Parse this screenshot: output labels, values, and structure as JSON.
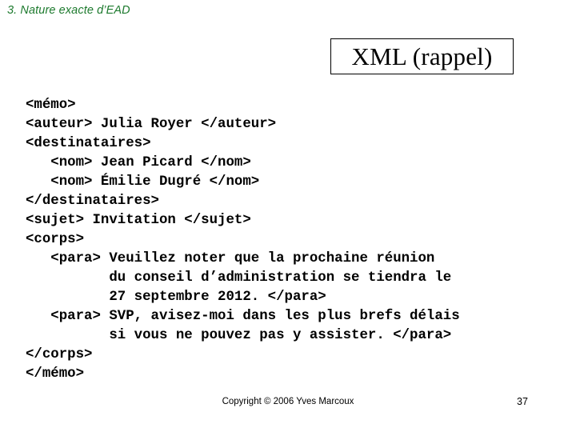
{
  "slide": {
    "section_header": "3. Nature exacte d’EAD",
    "header_color": "#1d7a2e",
    "background_color": "#ffffff",
    "title": "XML (rappel)"
  },
  "code": {
    "language": "xml",
    "lines": [
      "<mémo>",
      "<auteur> Julia Royer </auteur>",
      "<destinataires>",
      "   <nom> Jean Picard </nom>",
      "   <nom> Émilie Dugré </nom>",
      "</destinataires>",
      "<sujet> Invitation </sujet>",
      "<corps>",
      "   <para> Veuillez noter que la prochaine réunion",
      "          du conseil d’administration se tiendra le",
      "          27 septembre 2012. </para>",
      "   <para> SVP, avisez-moi dans les plus brefs délais",
      "          si vous ne pouvez pas y assister. </para>",
      "</corps>",
      "</mémo>"
    ]
  },
  "footer": {
    "copyright": "Copyright © 2006 Yves Marcoux",
    "page_number": "37"
  }
}
